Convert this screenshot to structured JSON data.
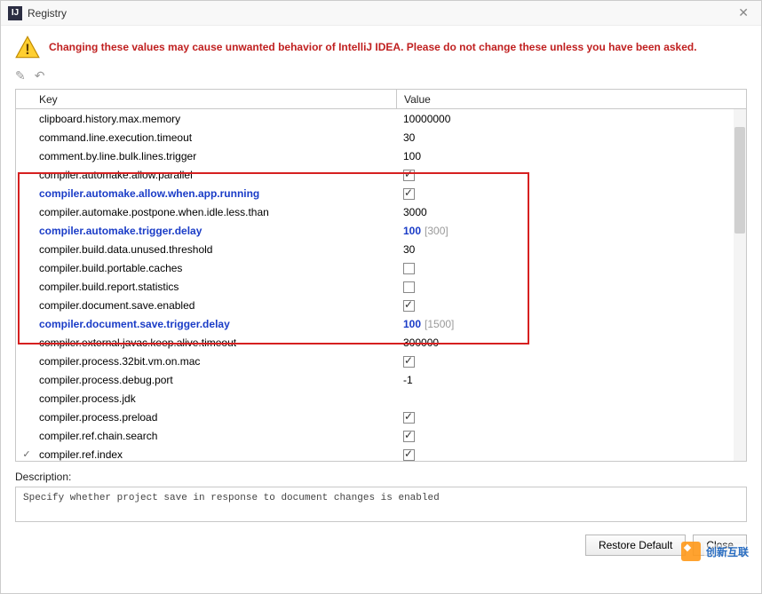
{
  "window": {
    "title": "Registry",
    "app_icon_letter": "IJ"
  },
  "warning": "Changing these values may cause unwanted behavior of IntelliJ IDEA. Please do not change these unless you have been asked.",
  "columns": {
    "key": "Key",
    "value": "Value"
  },
  "rows": [
    {
      "key": "clipboard.history.max.memory",
      "value": "10000000",
      "type": "text",
      "modified": false
    },
    {
      "key": "command.line.execution.timeout",
      "value": "30",
      "type": "text",
      "modified": false
    },
    {
      "key": "comment.by.line.bulk.lines.trigger",
      "value": "100",
      "type": "text",
      "modified": false
    },
    {
      "key": "compiler.automake.allow.parallel",
      "value": true,
      "type": "bool",
      "modified": false
    },
    {
      "key": "compiler.automake.allow.when.app.running",
      "value": true,
      "type": "bool",
      "modified": true
    },
    {
      "key": "compiler.automake.postpone.when.idle.less.than",
      "value": "3000",
      "type": "text",
      "modified": false
    },
    {
      "key": "compiler.automake.trigger.delay",
      "value": "100",
      "default": "300",
      "type": "text",
      "modified": true
    },
    {
      "key": "compiler.build.data.unused.threshold",
      "value": "30",
      "type": "text",
      "modified": false
    },
    {
      "key": "compiler.build.portable.caches",
      "value": false,
      "type": "bool",
      "modified": false
    },
    {
      "key": "compiler.build.report.statistics",
      "value": false,
      "type": "bool",
      "modified": false
    },
    {
      "key": "compiler.document.save.enabled",
      "value": true,
      "type": "bool",
      "modified": false
    },
    {
      "key": "compiler.document.save.trigger.delay",
      "value": "100",
      "default": "1500",
      "type": "text",
      "modified": true
    },
    {
      "key": "compiler.external.javac.keep.alive.timeout",
      "value": "300000",
      "type": "text",
      "modified": false
    },
    {
      "key": "compiler.process.32bit.vm.on.mac",
      "value": true,
      "type": "bool",
      "modified": false
    },
    {
      "key": "compiler.process.debug.port",
      "value": "-1",
      "type": "text",
      "modified": false
    },
    {
      "key": "compiler.process.jdk",
      "value": "",
      "type": "text",
      "modified": false
    },
    {
      "key": "compiler.process.preload",
      "value": true,
      "type": "bool",
      "modified": false
    },
    {
      "key": "compiler.ref.chain.search",
      "value": true,
      "type": "bool",
      "modified": false
    },
    {
      "key": "compiler.ref.index",
      "value": true,
      "type": "bool",
      "modified": false,
      "flag": "✓"
    }
  ],
  "description": {
    "label": "Description:",
    "text": "Specify whether project save in response to document changes is enabled"
  },
  "buttons": {
    "restore": "Restore Default",
    "close": "Close"
  },
  "watermark": "创新互联"
}
